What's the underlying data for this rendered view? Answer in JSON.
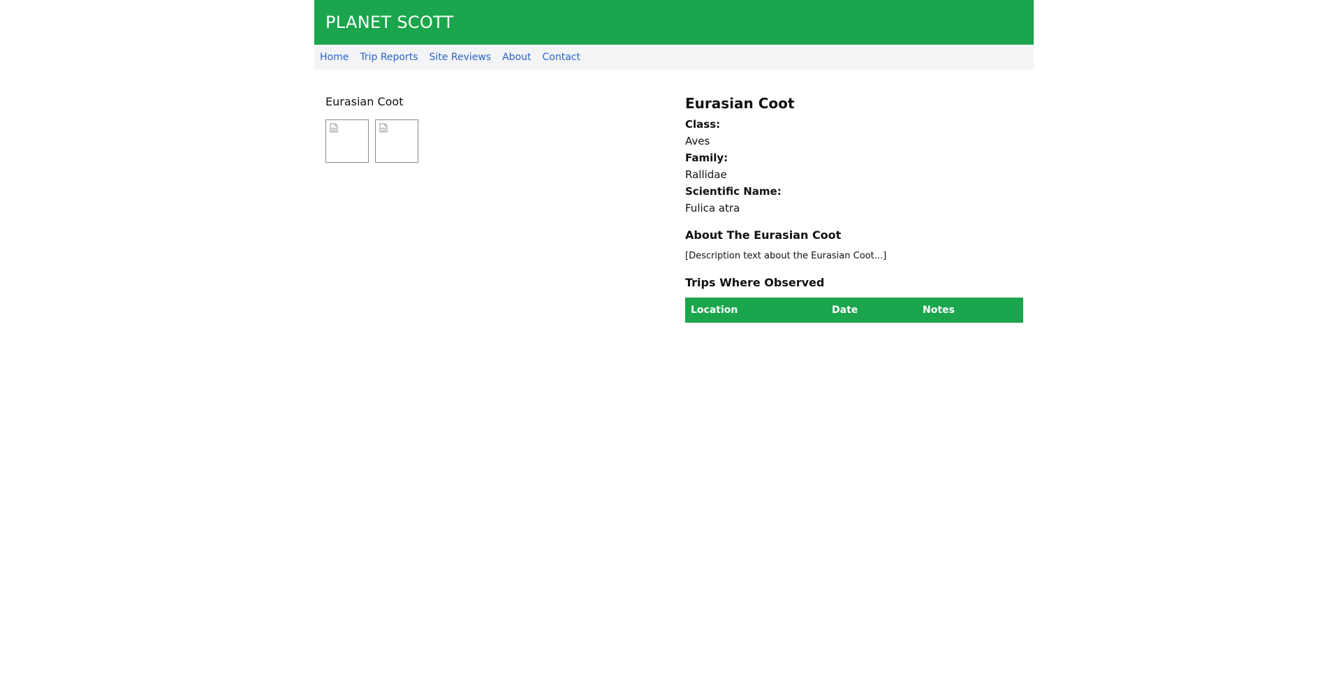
{
  "header": {
    "brand": "PLANET SCOTT"
  },
  "nav": {
    "items": [
      "Home",
      "Trip Reports",
      "Site Reviews",
      "About",
      "Contact"
    ]
  },
  "gallery": {
    "label": "Eurasian Coot",
    "thumbnail_count": 2,
    "icon": "broken-image-icon"
  },
  "species": {
    "title": "Eurasian Coot",
    "fields": [
      {
        "label": "Class:",
        "value": "Aves"
      },
      {
        "label": "Family:",
        "value": "Rallidae"
      },
      {
        "label": "Scientific Name:",
        "value": "Fulica atra"
      }
    ],
    "about_title": "About The Eurasian Coot",
    "description": "[Description text about the Eurasian Coot...]",
    "trips_title": "Trips Where Observed",
    "table_headers": [
      "Location",
      "Date",
      "Notes"
    ]
  },
  "colors": {
    "brand_green": "#1ba54c",
    "nav_background": "#f3f4f6",
    "link_blue": "#2a64c6"
  }
}
